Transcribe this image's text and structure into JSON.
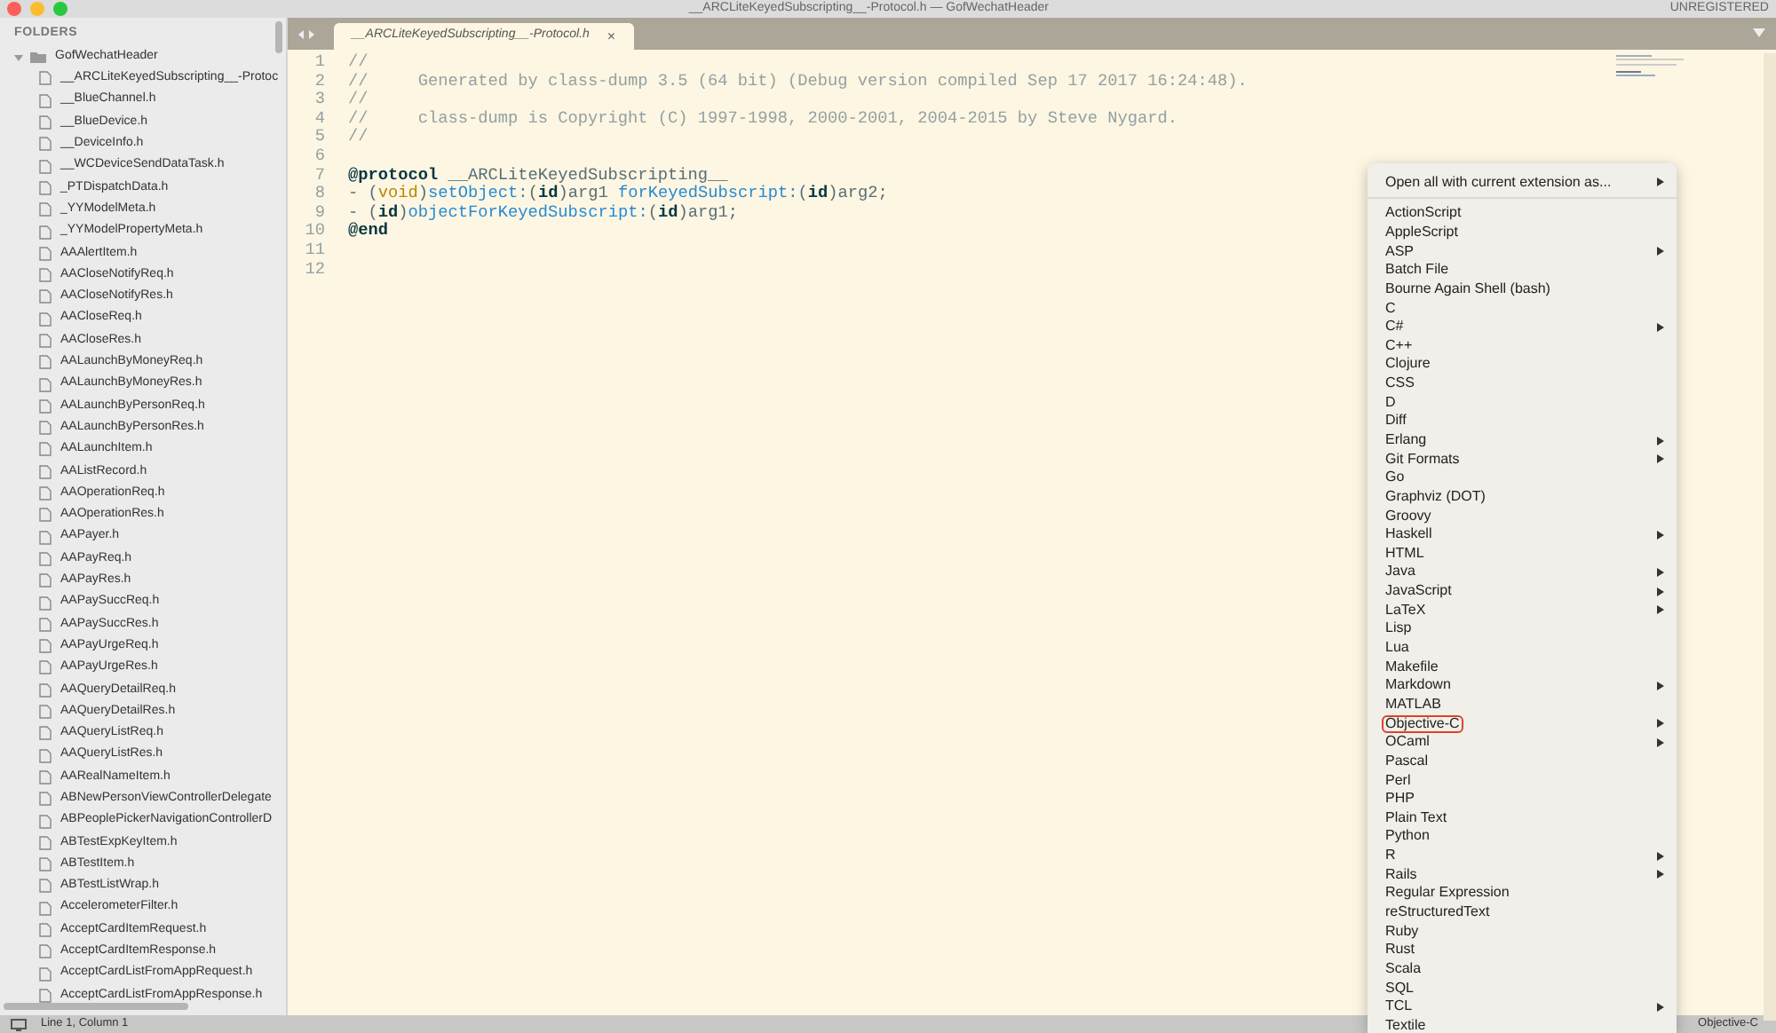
{
  "window": {
    "title": "__ARCLiteKeyedSubscripting__-Protocol.h — GofWechatHeader",
    "badge": "UNREGISTERED"
  },
  "sidebar": {
    "heading": "FOLDERS",
    "tree": [
      {
        "name": "GofWechatHeader",
        "expanded": true,
        "children": [
          {
            "name": "__ARCLiteKeyedSubscripting__-Protoc"
          },
          {
            "name": "__BlueChannel.h"
          },
          {
            "name": "__BlueDevice.h"
          },
          {
            "name": "__DeviceInfo.h"
          },
          {
            "name": "__WCDeviceSendDataTask.h"
          },
          {
            "name": "_PTDispatchData.h"
          },
          {
            "name": "_YYModelMeta.h"
          },
          {
            "name": "_YYModelPropertyMeta.h"
          },
          {
            "name": "AAAlertItem.h"
          },
          {
            "name": "AACloseNotifyReq.h"
          },
          {
            "name": "AACloseNotifyRes.h"
          },
          {
            "name": "AACloseReq.h"
          },
          {
            "name": "AACloseRes.h"
          },
          {
            "name": "AALaunchByMoneyReq.h"
          },
          {
            "name": "AALaunchByMoneyRes.h"
          },
          {
            "name": "AALaunchByPersonReq.h"
          },
          {
            "name": "AALaunchByPersonRes.h"
          },
          {
            "name": "AALaunchItem.h"
          },
          {
            "name": "AAListRecord.h"
          },
          {
            "name": "AAOperationReq.h"
          },
          {
            "name": "AAOperationRes.h"
          },
          {
            "name": "AAPayer.h"
          },
          {
            "name": "AAPayReq.h"
          },
          {
            "name": "AAPayRes.h"
          },
          {
            "name": "AAPaySuccReq.h"
          },
          {
            "name": "AAPaySuccRes.h"
          },
          {
            "name": "AAPayUrgeReq.h"
          },
          {
            "name": "AAPayUrgeRes.h"
          },
          {
            "name": "AAQueryDetailReq.h"
          },
          {
            "name": "AAQueryDetailRes.h"
          },
          {
            "name": "AAQueryListReq.h"
          },
          {
            "name": "AAQueryListRes.h"
          },
          {
            "name": "AARealNameItem.h"
          },
          {
            "name": "ABNewPersonViewControllerDelegate"
          },
          {
            "name": "ABPeoplePickerNavigationControllerD"
          },
          {
            "name": "ABTestExpKeyItem.h"
          },
          {
            "name": "ABTestItem.h"
          },
          {
            "name": "ABTestListWrap.h"
          },
          {
            "name": "AccelerometerFilter.h"
          },
          {
            "name": "AcceptCardItemRequest.h"
          },
          {
            "name": "AcceptCardItemResponse.h"
          },
          {
            "name": "AcceptCardListFromAppRequest.h"
          },
          {
            "name": "AcceptCardListFromAppResponse.h"
          }
        ]
      }
    ]
  },
  "tabs": [
    {
      "label": "__ARCLiteKeyedSubscripting__-Protocol.h",
      "selected": true,
      "close": "×"
    }
  ],
  "code_lines": [
    {
      "number": "1",
      "segments": [
        {
          "kind": "comment",
          "text": "//"
        }
      ]
    },
    {
      "number": "2",
      "segments": [
        {
          "kind": "comment",
          "text": "//     Generated by class-dump 3.5 (64 bit) (Debug version compiled Sep 17 2017 16:24:48)."
        }
      ]
    },
    {
      "number": "3",
      "segments": [
        {
          "kind": "comment",
          "text": "//"
        }
      ]
    },
    {
      "number": "4",
      "segments": [
        {
          "kind": "comment",
          "text": "//     class-dump is Copyright (C) 1997-1998, 2000-2001, 2004-2015 by Steve Nygard."
        }
      ]
    },
    {
      "number": "5",
      "segments": [
        {
          "kind": "comment",
          "text": "//"
        }
      ]
    },
    {
      "number": "6"
    },
    {
      "number": "7",
      "segments": [
        {
          "kind": "keyword",
          "text": "@protocol"
        },
        {
          "kind": "plain",
          "text": " __ARCLiteKeyedSubscripting__"
        }
      ]
    },
    {
      "number": "8",
      "segments": [
        {
          "kind": "plain",
          "text": "- ("
        },
        {
          "kind": "type",
          "text": "void"
        },
        {
          "kind": "plain",
          "text": ")"
        },
        {
          "kind": "method",
          "text": "setObject:"
        },
        {
          "kind": "plain",
          "text": "("
        },
        {
          "kind": "keyword",
          "text": "id"
        },
        {
          "kind": "plain",
          "text": ")arg1 "
        },
        {
          "kind": "method",
          "text": "forKeyedSubscript:"
        },
        {
          "kind": "plain",
          "text": "("
        },
        {
          "kind": "keyword",
          "text": "id"
        },
        {
          "kind": "plain",
          "text": ")arg2;"
        }
      ]
    },
    {
      "number": "9",
      "segments": [
        {
          "kind": "plain",
          "text": "- ("
        },
        {
          "kind": "keyword",
          "text": "id"
        },
        {
          "kind": "plain",
          "text": ")"
        },
        {
          "kind": "method",
          "text": "objectForKeyedSubscript:"
        },
        {
          "kind": "plain",
          "text": "("
        },
        {
          "kind": "keyword",
          "text": "id"
        },
        {
          "kind": "plain",
          "text": ")arg1;"
        }
      ]
    },
    {
      "number": "10",
      "segments": [
        {
          "kind": "keyword",
          "text": "@end"
        }
      ]
    },
    {
      "number": "11"
    },
    {
      "number": "12"
    }
  ],
  "context_menu": {
    "header": {
      "label": "Open all with current extension as...",
      "submenu": true
    },
    "items": [
      {
        "label": "ActionScript",
        "submenu": false,
        "marked": false
      },
      {
        "label": "AppleScript",
        "submenu": false,
        "marked": false
      },
      {
        "label": "ASP",
        "submenu": true,
        "marked": false
      },
      {
        "label": "Batch File",
        "submenu": false,
        "marked": false
      },
      {
        "label": "Bourne Again Shell (bash)",
        "submenu": false,
        "marked": false
      },
      {
        "label": "C",
        "submenu": false,
        "marked": false
      },
      {
        "label": "C#",
        "submenu": true,
        "marked": false
      },
      {
        "label": "C++",
        "submenu": false,
        "marked": false
      },
      {
        "label": "Clojure",
        "submenu": false,
        "marked": false
      },
      {
        "label": "CSS",
        "submenu": false,
        "marked": false
      },
      {
        "label": "D",
        "submenu": false,
        "marked": false
      },
      {
        "label": "Diff",
        "submenu": false,
        "marked": false
      },
      {
        "label": "Erlang",
        "submenu": true,
        "marked": false
      },
      {
        "label": "Git Formats",
        "submenu": true,
        "marked": false
      },
      {
        "label": "Go",
        "submenu": false,
        "marked": false
      },
      {
        "label": "Graphviz (DOT)",
        "submenu": false,
        "marked": false
      },
      {
        "label": "Groovy",
        "submenu": false,
        "marked": false
      },
      {
        "label": "Haskell",
        "submenu": true,
        "marked": false
      },
      {
        "label": "HTML",
        "submenu": false,
        "marked": false
      },
      {
        "label": "Java",
        "submenu": true,
        "marked": false
      },
      {
        "label": "JavaScript",
        "submenu": true,
        "marked": false
      },
      {
        "label": "LaTeX",
        "submenu": true,
        "marked": false
      },
      {
        "label": "Lisp",
        "submenu": false,
        "marked": false
      },
      {
        "label": "Lua",
        "submenu": false,
        "marked": false
      },
      {
        "label": "Makefile",
        "submenu": false,
        "marked": false
      },
      {
        "label": "Markdown",
        "submenu": true,
        "marked": false
      },
      {
        "label": "MATLAB",
        "submenu": false,
        "marked": false
      },
      {
        "label": "Objective-C",
        "submenu": true,
        "marked": true
      },
      {
        "label": "OCaml",
        "submenu": true,
        "marked": false
      },
      {
        "label": "Pascal",
        "submenu": false,
        "marked": false
      },
      {
        "label": "Perl",
        "submenu": false,
        "marked": false
      },
      {
        "label": "PHP",
        "submenu": false,
        "marked": false
      },
      {
        "label": "Plain Text",
        "submenu": false,
        "marked": false
      },
      {
        "label": "Python",
        "submenu": false,
        "marked": false
      },
      {
        "label": "R",
        "submenu": true,
        "marked": false
      },
      {
        "label": "Rails",
        "submenu": true,
        "marked": false
      },
      {
        "label": "Regular Expression",
        "submenu": false,
        "marked": false
      },
      {
        "label": "reStructuredText",
        "submenu": false,
        "marked": false
      },
      {
        "label": "Ruby",
        "submenu": false,
        "marked": false
      },
      {
        "label": "Rust",
        "submenu": false,
        "marked": false
      },
      {
        "label": "Scala",
        "submenu": false,
        "marked": false
      },
      {
        "label": "SQL",
        "submenu": false,
        "marked": false
      },
      {
        "label": "TCL",
        "submenu": true,
        "marked": false
      },
      {
        "label": "Textile",
        "submenu": false,
        "marked": false
      }
    ]
  },
  "status_bar": {
    "position": "Line 1, Column 1",
    "syntax": "Objective-C"
  }
}
